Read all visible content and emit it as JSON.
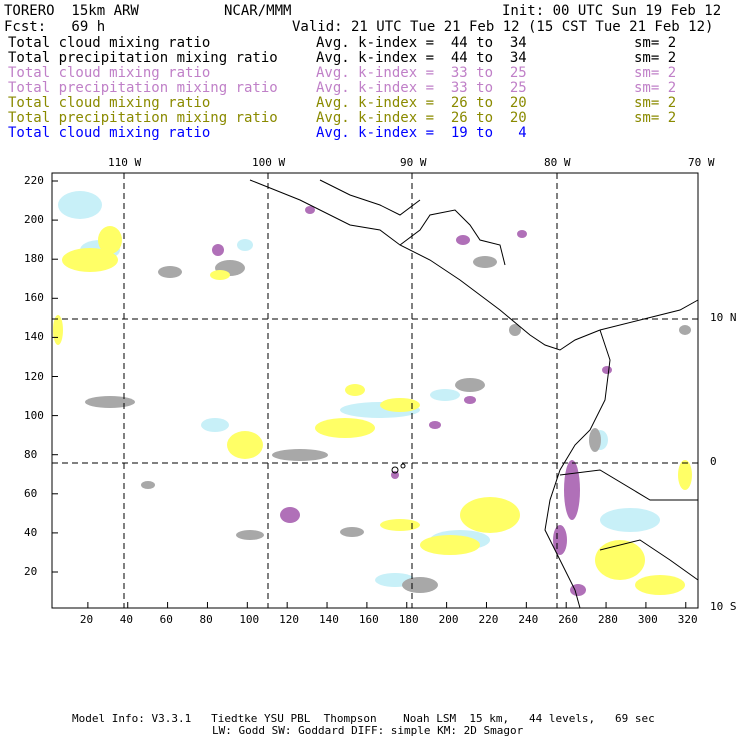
{
  "header": {
    "model": "TORERO  15km ARW",
    "org": "NCAR/MMM",
    "init": "Init: 00 UTC Sun 19 Feb 12",
    "fcst": "Fcst:   69 h",
    "valid": "Valid: 21 UTC Tue 21 Feb 12 (15 CST Tue 21 Feb 12)"
  },
  "legend": [
    {
      "field": "Total cloud mixing ratio",
      "range": "Avg. k-index =  44 to  34",
      "sm": "sm= 2",
      "color": "#000000"
    },
    {
      "field": "Total precipitation mixing ratio",
      "range": "Avg. k-index =  44 to  34",
      "sm": "sm= 2",
      "color": "#000000"
    },
    {
      "field": "Total cloud mixing ratio",
      "range": "Avg. k-index =  33 to  25",
      "sm": "sm= 2",
      "color": "#c080c8"
    },
    {
      "field": "Total precipitation mixing ratio",
      "range": "Avg. k-index =  33 to  25",
      "sm": "sm= 2",
      "color": "#c080c8"
    },
    {
      "field": "Total cloud mixing ratio",
      "range": "Avg. k-index =  26 to  20",
      "sm": "sm= 2",
      "color": "#8a8a00"
    },
    {
      "field": "Total precipitation mixing ratio",
      "range": "Avg. k-index =  26 to  20",
      "sm": "sm= 2",
      "color": "#8a8a00"
    },
    {
      "field": "Total cloud mixing ratio",
      "range": "Avg. k-index =  19 to   4",
      "sm": "",
      "color": "#0000ff"
    }
  ],
  "map": {
    "lon_labels": [
      "110 W",
      "100 W",
      "90 W",
      "80 W",
      "70 W"
    ],
    "lat_labels": [
      "10 N",
      "0",
      "10 S"
    ],
    "x_ticks": [
      "20",
      "40",
      "60",
      "80",
      "100",
      "120",
      "140",
      "160",
      "180",
      "200",
      "220",
      "240",
      "260",
      "280",
      "300",
      "320"
    ],
    "y_ticks": [
      "220",
      "200",
      "180",
      "160",
      "140",
      "120",
      "100",
      "80",
      "60",
      "40",
      "20"
    ],
    "colors": {
      "gray": "#a8a8a8",
      "purple": "#b070b8",
      "yellow": "#ffff66",
      "lightblue": "#c8f0f8"
    }
  },
  "footer": {
    "line1": "Model Info: V3.3.1   Tiedtke YSU PBL  Thompson    Noah LSM  15 km,   44 levels,   69 sec",
    "line2": "LW: Godd SW: Goddard DIFF: simple KM: 2D Smagor"
  }
}
